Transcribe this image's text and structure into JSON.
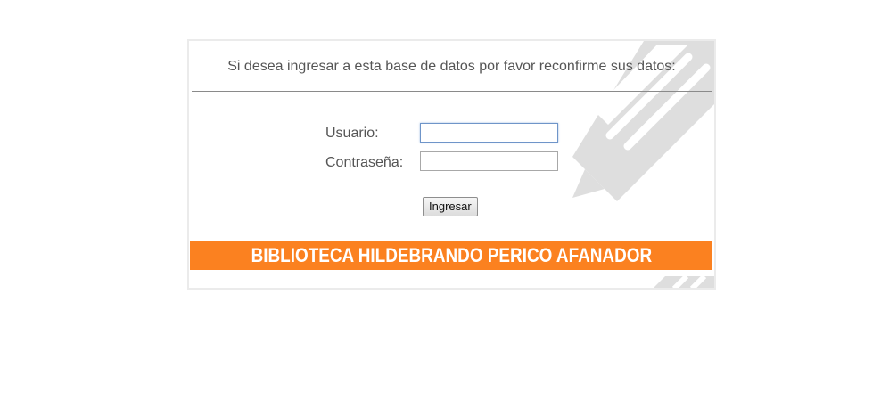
{
  "login": {
    "message": "Si desea ingresar a esta base de datos por favor reconfirme sus datos:",
    "user_label": "Usuario:",
    "user_value": "",
    "password_label": "Contraseña:",
    "password_value": "",
    "submit_label": "Ingresar"
  },
  "banner": {
    "text": "BIBLIOTECA HILDEBRANDO PERICO AFANADOR",
    "color": "#fb8120"
  },
  "decoration": {
    "icon": "pencil-icon",
    "color": "#dcdcdc"
  }
}
